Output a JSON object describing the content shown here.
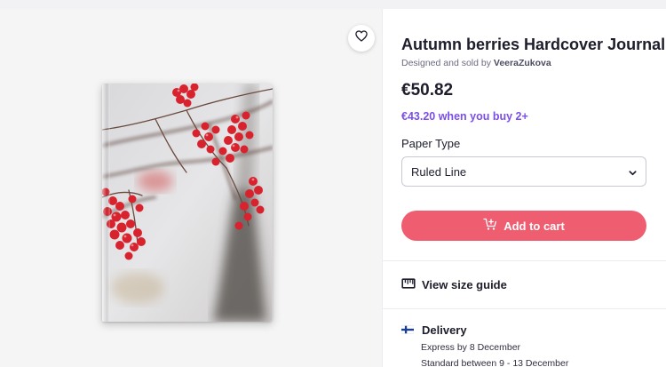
{
  "product": {
    "title": "Autumn berries Hardcover Journal",
    "byline_prefix": "Designed and sold by",
    "artist": "VeeraZukova",
    "price": "€50.82",
    "bulk_offer": "€43.20 when you buy 2+"
  },
  "options": {
    "paper_type_label": "Paper Type",
    "paper_type_selected": "Ruled Line"
  },
  "actions": {
    "add_to_cart": "Add to cart",
    "size_guide": "View size guide"
  },
  "delivery": {
    "heading": "Delivery",
    "express": "Express by 8 December",
    "standard": "Standard between 9 - 13 December"
  },
  "icons": {
    "favorite": "heart-icon",
    "dropdown": "chevron-down-icon",
    "cart": "cart-add-icon",
    "ruler": "ruler-icon",
    "flag": "finland-flag-icon"
  },
  "colors": {
    "cart_button": "#ef5d70",
    "bulk_offer": "#7b4ee6",
    "text": "#1d1d2c"
  }
}
